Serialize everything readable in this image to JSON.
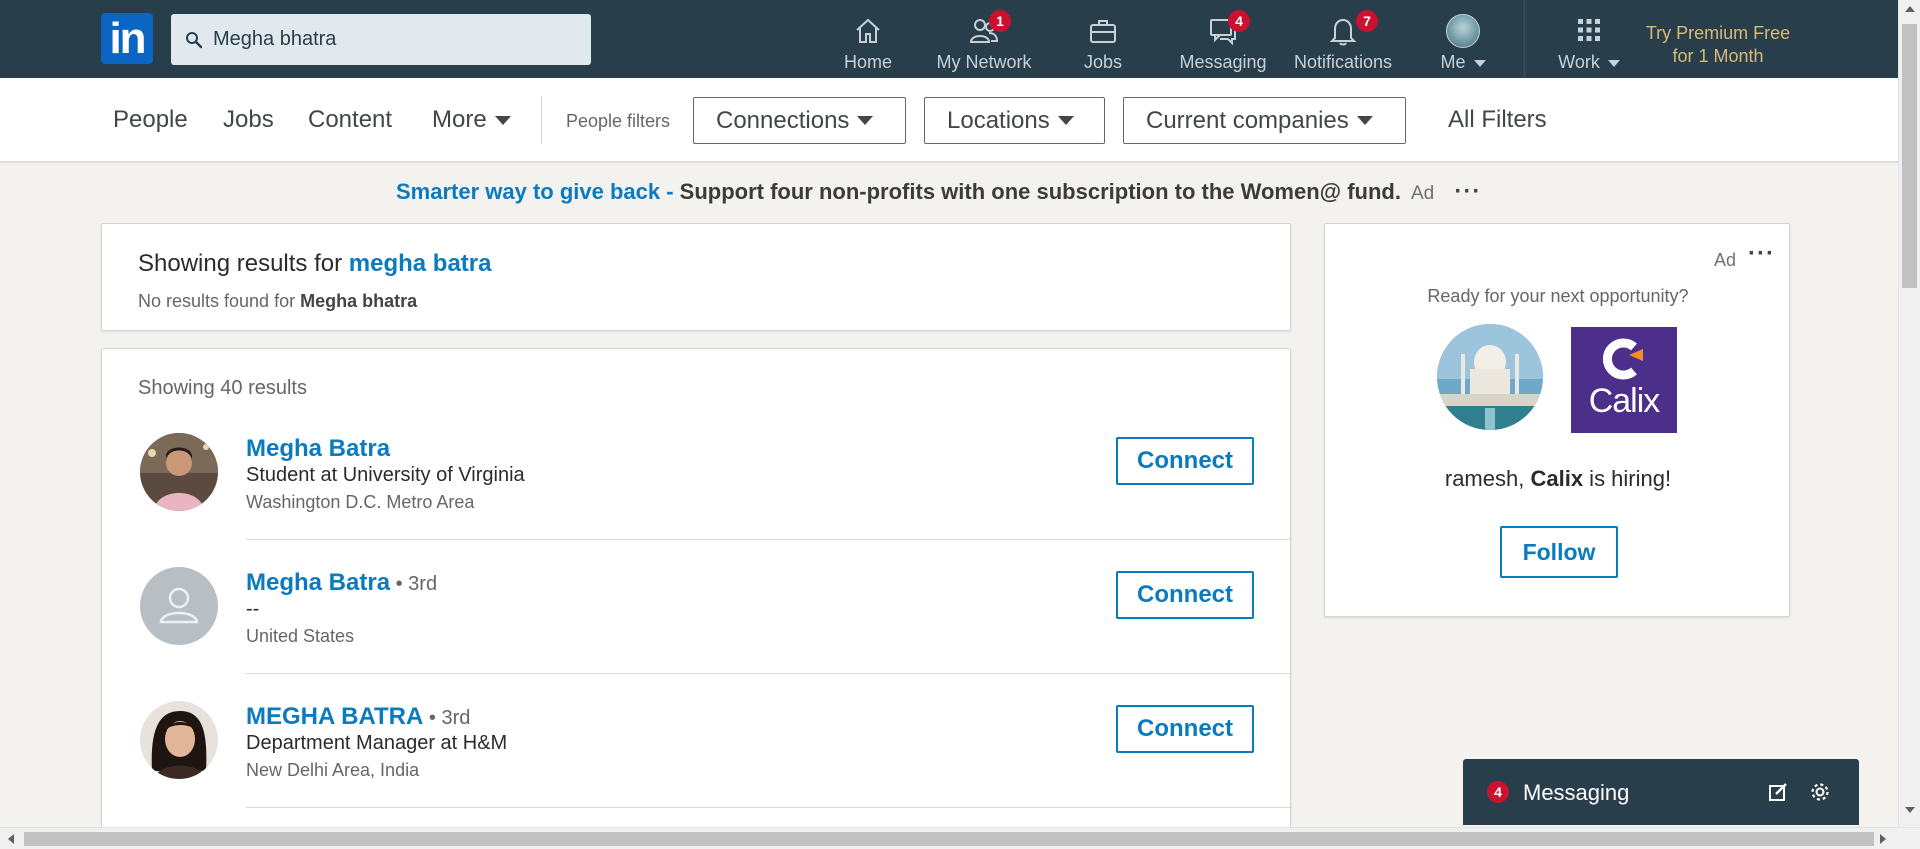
{
  "nav": {
    "logo_text": "in",
    "search_value": "Megha bhatra",
    "items": [
      {
        "label": "Home",
        "icon": "home-icon",
        "badge": ""
      },
      {
        "label": "My Network",
        "icon": "network-icon",
        "badge": "1"
      },
      {
        "label": "Jobs",
        "icon": "briefcase-icon",
        "badge": ""
      },
      {
        "label": "Messaging",
        "icon": "messaging-icon",
        "badge": "4"
      },
      {
        "label": "Notifications",
        "icon": "bell-icon",
        "badge": "7"
      },
      {
        "label": "Me",
        "icon": "avatar",
        "badge": ""
      },
      {
        "label": "Work",
        "icon": "grid-icon",
        "badge": ""
      }
    ],
    "premium_line1": "Try Premium Free",
    "premium_line2": "for 1 Month"
  },
  "filters": {
    "tabs": [
      "People",
      "Jobs",
      "Content",
      "More"
    ],
    "people_filters_label": "People filters",
    "dropdowns": [
      "Connections",
      "Locations",
      "Current companies"
    ],
    "all_filters": "All Filters"
  },
  "ad_banner": {
    "highlight": "Smarter way to give back - ",
    "text": "Support four non-profits with one subscription to the Women@ fund.",
    "tag": "Ad",
    "more": "···"
  },
  "spelling": {
    "prefix": "Showing results for ",
    "suggestion": "megha batra",
    "no_results_prefix": "No results found for ",
    "original_query": "Megha bhatra"
  },
  "results": {
    "count_text": "Showing 40 results",
    "items": [
      {
        "name": "Megha Batra",
        "degree": "",
        "headline": "Student at University of Virginia",
        "location": "Washington D.C. Metro Area",
        "action": "Connect"
      },
      {
        "name": "Megha Batra",
        "degree": " • 3rd",
        "headline": "--",
        "location": "United States",
        "action": "Connect"
      },
      {
        "name": "MEGHA BATRA",
        "degree": " • 3rd",
        "headline": "Department Manager at H&M",
        "location": "New Delhi Area, India",
        "action": "Connect"
      }
    ]
  },
  "right_ad": {
    "tag": "Ad",
    "more": "···",
    "ready": "Ready for your next opportunity?",
    "company_logo_text": "Calix",
    "hiring_name": "ramesh, ",
    "hiring_company": "Calix",
    "hiring_suffix": " is hiring!",
    "follow": "Follow"
  },
  "messaging_dock": {
    "badge": "4",
    "label": "Messaging"
  },
  "colors": {
    "nav_bg": "#283e4a",
    "link_blue": "#0a7bbf",
    "badge_red": "#cb112d",
    "premium_gold": "#d9b97a",
    "calix_purple": "#4b2f8a",
    "calix_orange": "#f28c28"
  }
}
